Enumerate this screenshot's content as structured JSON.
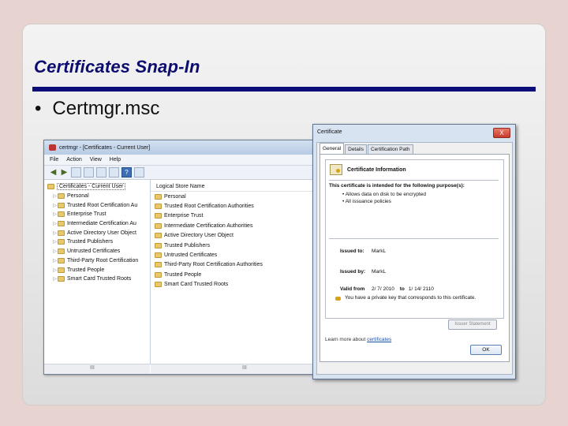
{
  "slide": {
    "title": "Certificates Snap-In",
    "bullet": "Certmgr.msc"
  },
  "certmgr": {
    "window_title": "certmgr - [Certificates - Current User]",
    "menu": [
      "File",
      "Action",
      "View",
      "Help"
    ],
    "tree_root": "Certificates - Current User",
    "tree_items": [
      "Personal",
      "Trusted Root Certification Au",
      "Enterprise Trust",
      "Intermediate Certification Au",
      "Active Directory User Object",
      "Trusted Publishers",
      "Untrusted Certificates",
      "Third-Party Root Certification",
      "Trusted People",
      "Smart Card Trusted Roots"
    ],
    "column_header": "Logical Store Name",
    "list_items": [
      "Personal",
      "Trusted Root Certification Authorities",
      "Enterprise Trust",
      "Intermediate Certification Authorities",
      "Active Directory User Object",
      "Trusted Publishers",
      "Untrusted Certificates",
      "Third-Party Root Certification Authorities",
      "Trusted People",
      "Smart Card Trusted Roots"
    ],
    "scroll_mark": "III"
  },
  "certificate_dialog": {
    "title": "Certificate",
    "close_glyph": "X",
    "tabs": [
      "General",
      "Details",
      "Certification Path"
    ],
    "info_title": "Certificate Information",
    "purpose_heading": "This certificate is intended for the following purpose(s):",
    "purposes": [
      "• Allows data on disk to be encrypted",
      "• All issuance policies"
    ],
    "issued_to_label": "Issued to:",
    "issued_to_value": "MarkL",
    "issued_by_label": "Issued by:",
    "issued_by_value": "MarkL",
    "valid_from_label": "Valid from",
    "valid_from": "2/ 7/ 2010",
    "valid_to_word": "to",
    "valid_to": "1/ 14/ 2110",
    "private_key_note": "You have a private key that corresponds to this certificate.",
    "issuer_button": "Issuer Statement",
    "learn_prefix": "Learn more about ",
    "learn_link": "certificates",
    "ok_button": "OK"
  }
}
